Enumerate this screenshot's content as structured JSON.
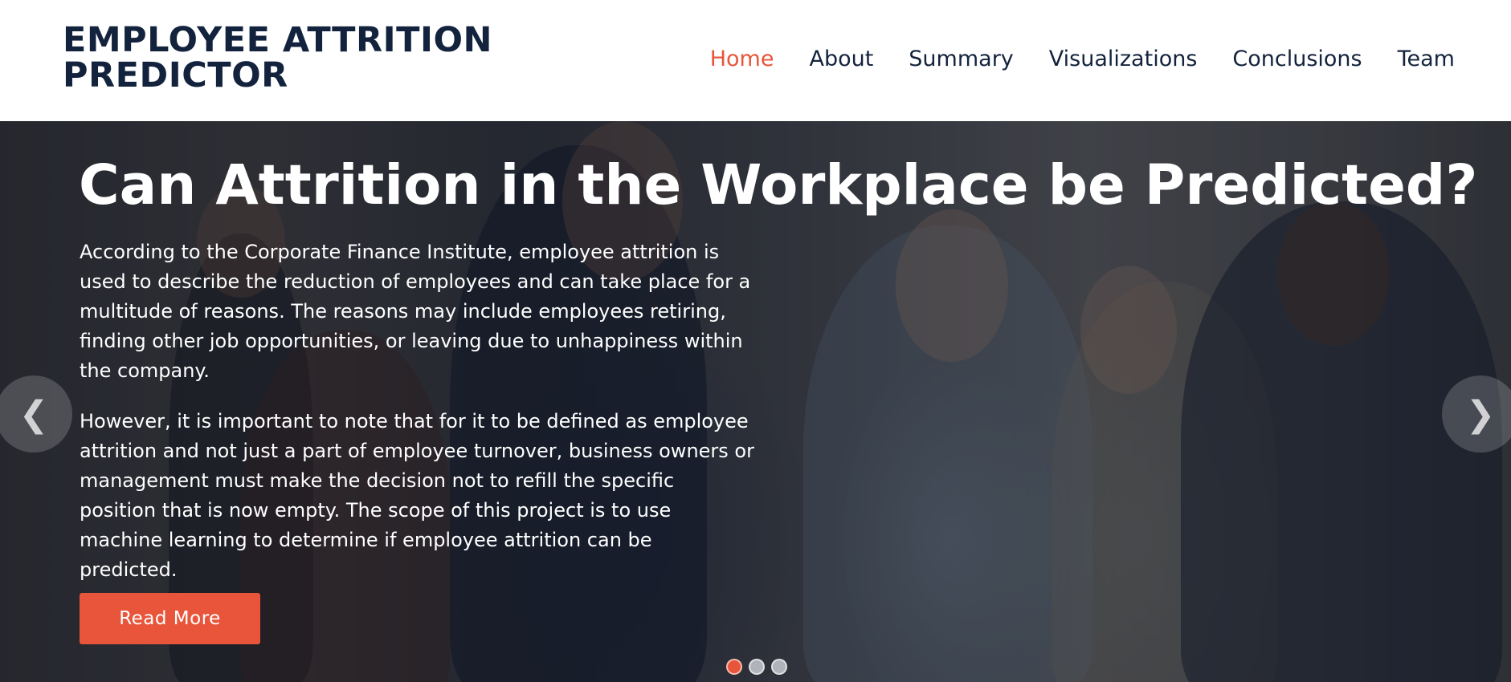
{
  "brand": {
    "line1": "EMPLOYEE ATTRITION",
    "line2": "PREDICTOR"
  },
  "nav": {
    "home": "Home",
    "about": "About",
    "summary": "Summary",
    "visualizations": "Visualizations",
    "conclusions": "Conclusions",
    "team": "Team",
    "active": "Home"
  },
  "hero": {
    "title": "Can Attrition in the Workplace be Predicted?",
    "paragraph1": "According to the Corporate Finance Institute, employee attrition is used to describe the reduction of employees and can take place for a multitude of reasons. The reasons may include employees retiring, finding other job opportunities, or leaving due to unhappiness within the company.",
    "paragraph2": "However, it is important to note that for it to be defined as employee attrition and not just a part of employee turnover, business owners or management must make the decision not to refill the specific position that is now empty. The scope of this project is to use machine learning to determine if employee attrition can be predicted.",
    "button_label": "Read More",
    "prev_icon": "chevron-left-icon",
    "next_icon": "chevron-right-icon",
    "slides_total": 3,
    "slide_active": 1
  },
  "colors": {
    "accent": "#e8553a",
    "brand_text": "#14233d",
    "hero_text": "#ffffff"
  }
}
